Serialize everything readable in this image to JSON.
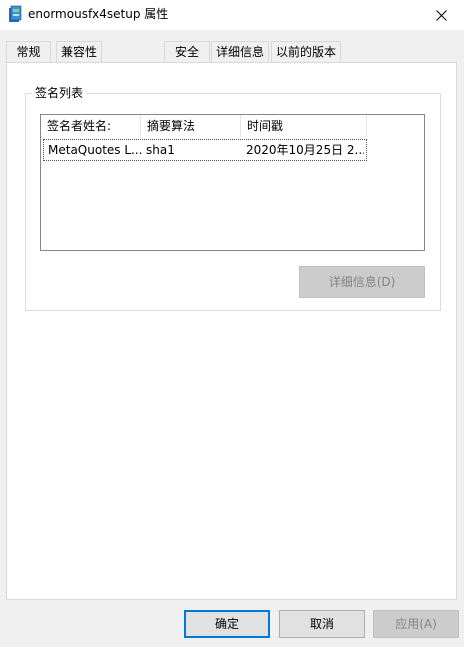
{
  "window": {
    "title": "enormousfx4setup 属性",
    "app_icon": "installer-icon",
    "close_icon": "close-icon"
  },
  "tabs": [
    {
      "label": "常规",
      "active": false
    },
    {
      "label": "兼容性",
      "active": false
    },
    {
      "label": "安全",
      "active": false
    },
    {
      "label": "详细信息",
      "active": false
    },
    {
      "label": "以前的版本",
      "active": false
    }
  ],
  "signatures": {
    "group_label": "签名列表",
    "columns": [
      "签名者姓名:",
      "摘要算法",
      "时间戳"
    ],
    "rows": [
      {
        "name": "MetaQuotes L...",
        "algorithm": "sha1",
        "timestamp": "2020年10月25日 2..."
      }
    ],
    "details_button": "详细信息(D)"
  },
  "footer": {
    "ok": "确定",
    "cancel": "取消",
    "apply": "应用(A)"
  },
  "colors": {
    "focus_border": "#0078d7",
    "disabled_button": "#cccccc"
  }
}
